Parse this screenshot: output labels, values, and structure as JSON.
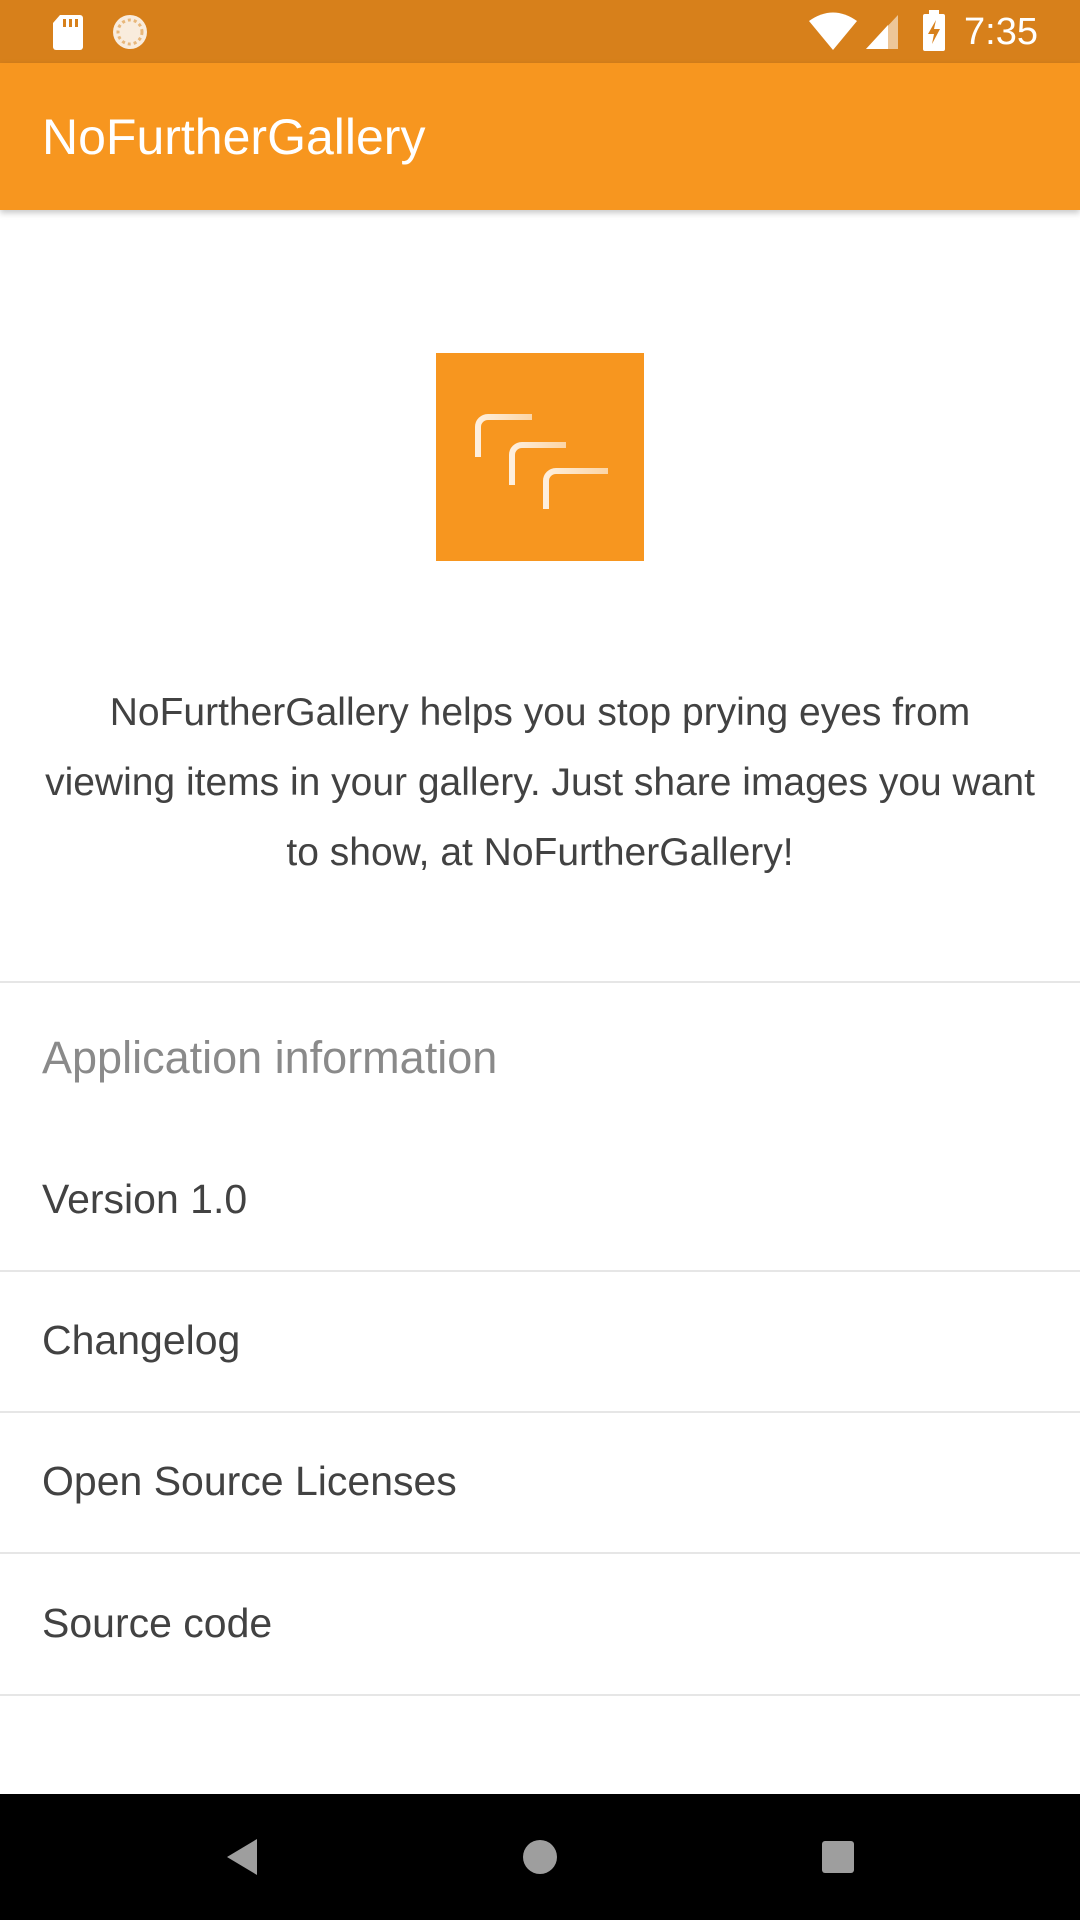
{
  "status_bar": {
    "time": "7:35",
    "icons": [
      "sd-card-icon",
      "sync-icon",
      "wifi-icon",
      "signal-icon",
      "battery-charging-icon"
    ]
  },
  "app_bar": {
    "title": "NoFurtherGallery"
  },
  "logo": {
    "icon": "stacked-windows-icon",
    "background_color": "#F7961F"
  },
  "description": "NoFurtherGallery helps you stop prying eyes from viewing items in your gallery. Just share images you want to show, at NoFurtherGallery!",
  "info_section": {
    "header": "Application information",
    "items": [
      {
        "label": "Version 1.0"
      },
      {
        "label": "Changelog"
      },
      {
        "label": "Open Source Licenses"
      },
      {
        "label": "Source code"
      }
    ]
  },
  "nav_bar": {
    "icons": [
      "back-icon",
      "home-icon",
      "recents-icon"
    ]
  },
  "colors": {
    "status_bar": "#D7801B",
    "app_bar": "#F7961F",
    "text_primary": "#424242",
    "text_secondary": "#8a8a8a",
    "divider": "#e6e6e6"
  }
}
